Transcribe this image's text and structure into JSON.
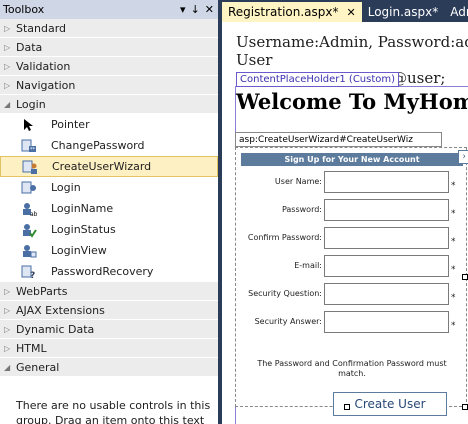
{
  "toolbox": {
    "title": "Toolbox",
    "controls": {
      "pin": "↓",
      "close": "✕",
      "dropdown": "▾"
    },
    "groups_before": [
      {
        "label": "Standard"
      },
      {
        "label": "Data"
      },
      {
        "label": "Validation"
      },
      {
        "label": "Navigation"
      }
    ],
    "login_group": {
      "label": "Login",
      "items": [
        {
          "label": "Pointer",
          "icon": "pointer-icon"
        },
        {
          "label": "ChangePassword",
          "icon": "change-password-icon"
        },
        {
          "label": "CreateUserWizard",
          "icon": "create-user-wizard-icon",
          "selected": true
        },
        {
          "label": "Login",
          "icon": "login-icon"
        },
        {
          "label": "LoginName",
          "icon": "login-name-icon"
        },
        {
          "label": "LoginStatus",
          "icon": "login-status-icon"
        },
        {
          "label": "LoginView",
          "icon": "login-view-icon"
        },
        {
          "label": "PasswordRecovery",
          "icon": "password-recovery-icon"
        }
      ]
    },
    "groups_after": [
      {
        "label": "WebParts"
      },
      {
        "label": "AJAX Extensions"
      },
      {
        "label": "Dynamic Data"
      },
      {
        "label": "HTML"
      },
      {
        "label": "General"
      }
    ],
    "empty_message": "There are no usable controls in this group. Drag an item onto this text to"
  },
  "tabs": [
    {
      "label": "Registration.aspx*",
      "active": true,
      "close": "✕"
    },
    {
      "label": "Login.aspx*",
      "active": false
    },
    {
      "label": "Adm",
      "active": false
    }
  ],
  "design": {
    "line1": "Username:Admin, Password:admin ,",
    "line2": "User",
    "line3": "@user;",
    "cph_tag": "ContentPlaceHolder1 (Custom)",
    "welcome": "Welcome To MyHomeL",
    "wizard_tag": "asp:CreateUserWizard#CreateUserWiz",
    "wizard": {
      "header": "Sign Up for Your New Account",
      "fields": [
        {
          "label": "User Name:"
        },
        {
          "label": "Password:"
        },
        {
          "label": "Confirm Password:"
        },
        {
          "label": "E-mail:"
        },
        {
          "label": "Security Question:"
        },
        {
          "label": "Security Answer:"
        }
      ],
      "required_mark": "*",
      "compare_message": "The Password and Confirmation Password must match.",
      "create_button": "Create User",
      "smart_tag": "›"
    }
  },
  "colors": {
    "tab_bar": "#2b3c59",
    "active_tab": "#fff5c4",
    "selection": "#fdf0c3",
    "wizard_header": "#5d7b9d"
  }
}
